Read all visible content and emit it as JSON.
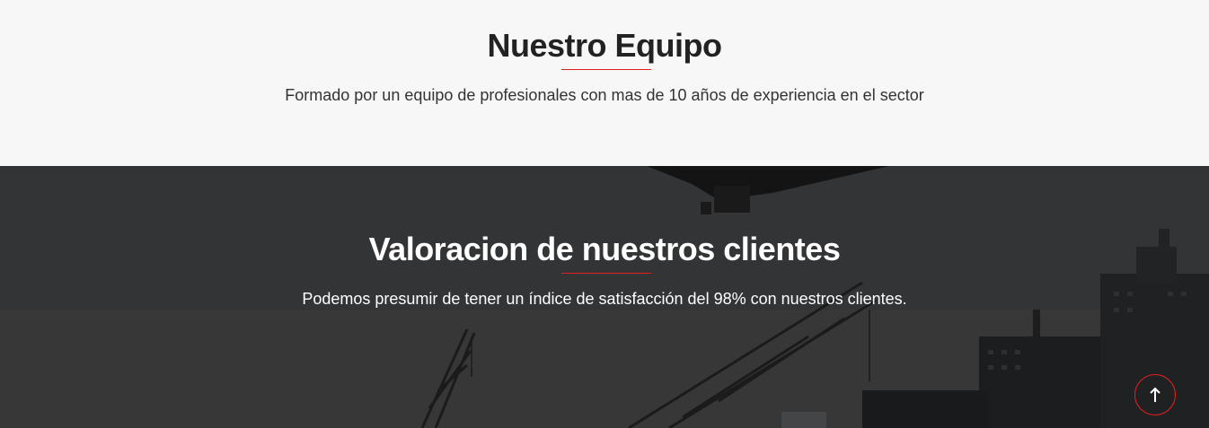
{
  "team": {
    "title": "Nuestro Equipo",
    "subtitle": "Formado por un equipo de profesionales con mas de 10 años de experiencia en el sector"
  },
  "reviews": {
    "title": "Valoracion de nuestros clientes",
    "subtitle": "Podemos presumir de tener un índice de satisfacción del 98% con nuestros clientes."
  },
  "back_to_top": {
    "icon": "arrow-up-icon"
  },
  "colors": {
    "accent": "#e02020",
    "light_bg": "#f7f7f7",
    "dark_overlay": "#333333",
    "heading_dark": "#222222"
  }
}
